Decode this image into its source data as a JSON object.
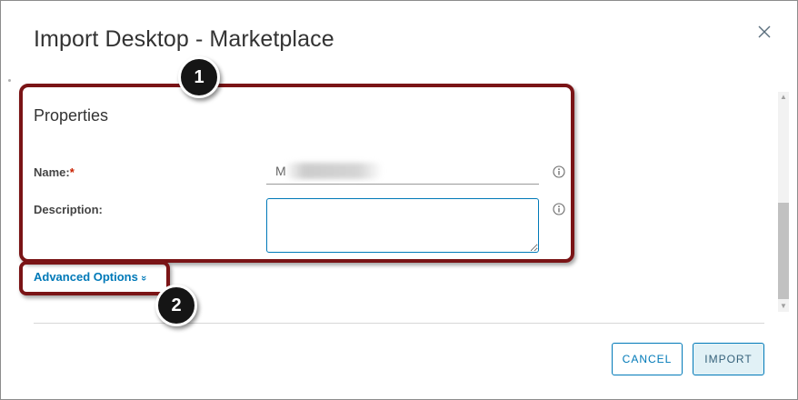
{
  "dialog": {
    "title": "Import Desktop - Marketplace",
    "close_icon": "close-icon"
  },
  "properties": {
    "section_title": "Properties",
    "name_label": "Name:",
    "name_required_mark": "*",
    "name_value": "M",
    "description_label": "Description:",
    "description_value": "",
    "info_icon": "info-icon"
  },
  "advanced": {
    "label": "Advanced Options",
    "chevron": "»",
    "chevron_icon": "chevron-double-down-icon"
  },
  "footer": {
    "cancel_label": "CANCEL",
    "import_label": "IMPORT"
  },
  "annotations": {
    "callout_1": "1",
    "callout_2": "2",
    "border_color": "#7a1416"
  },
  "colors": {
    "accent": "#0079b8",
    "required": "#c92100"
  }
}
